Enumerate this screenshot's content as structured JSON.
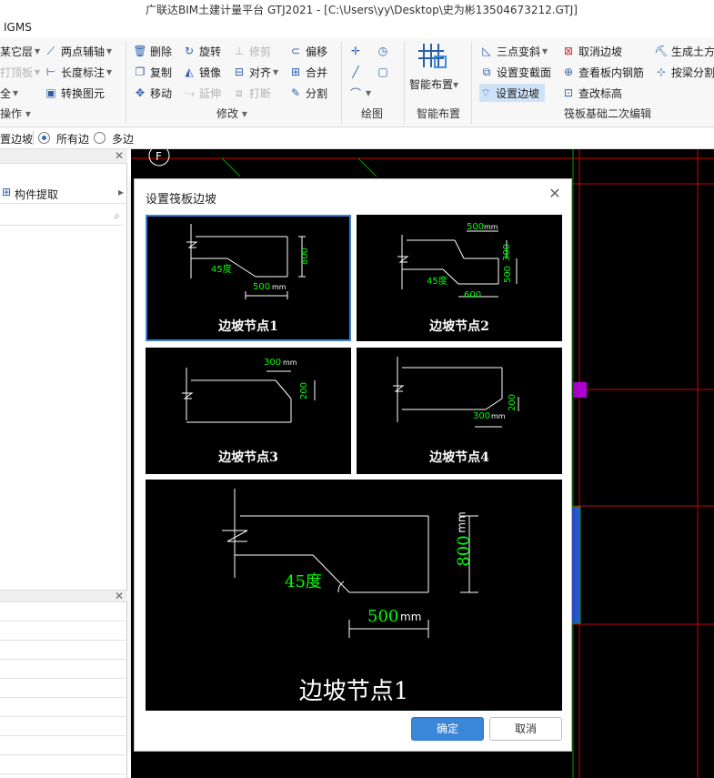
{
  "window": {
    "title": "广联达BIM土建计量平台 GTJ2021 - [C:\\Users\\yy\\Desktop\\史为彬13504673212.GTJ]"
  },
  "menu": {
    "first_item": "IGMS"
  },
  "ribbon": {
    "left_group": {
      "items": [
        "某它层",
        "打顶板",
        "全"
      ],
      "label": "操作"
    },
    "group2": {
      "items": [
        "两点辅轴",
        "长度标注",
        "转换图元"
      ]
    },
    "modify": {
      "label": "修改",
      "items": [
        "删除",
        "旋转",
        "修剪",
        "偏移",
        "复制",
        "镜像",
        "对齐",
        "合并",
        "移动",
        "延伸",
        "打断",
        "分割"
      ]
    },
    "draw": {
      "label": "绘图"
    },
    "smart": {
      "label": "智能布置",
      "button": "智能布置"
    },
    "raft": {
      "label": "筏板基础二次编辑",
      "items": [
        "三点变斜",
        "取消边坡",
        "生成土方",
        "设置变截面",
        "查看板内钢筋",
        "按梁分割",
        "设置边坡",
        "查改标高"
      ]
    }
  },
  "options_bar": {
    "prefix": "置边坡",
    "option1": "所有边",
    "option2": "多边",
    "selected": "option1"
  },
  "left_panel": {
    "tab": "构件提取"
  },
  "canvas": {
    "axis_label": "F"
  },
  "dialog": {
    "title": "设置筏板边坡",
    "nodes": [
      {
        "label": "边坡节点1",
        "angle": "45度",
        "dim_h": "800",
        "dim_w": "500",
        "unit": "mm"
      },
      {
        "label": "边坡节点2",
        "angle": "45度",
        "dim_top": "500",
        "dim_h1": "300",
        "dim_h2": "500",
        "dim_w": "600",
        "unit": "mm"
      },
      {
        "label": "边坡节点3",
        "dim_w": "300",
        "dim_h": "200",
        "unit": "mm"
      },
      {
        "label": "边坡节点4",
        "dim_w": "300",
        "dim_h": "200",
        "unit": "mm"
      }
    ],
    "selected_node": "边坡节点1",
    "preview": {
      "label": "边坡节点1",
      "angle": "45度",
      "dim_h": "800",
      "dim_w": "500",
      "unit": "mm"
    },
    "ok": "确定",
    "cancel": "取消"
  },
  "colors": {
    "accent": "#3a86d8",
    "dim_green": "#00ff00",
    "grid_red": "#e00000",
    "grid_green": "#00aa00",
    "magenta": "#b000d0",
    "blue_bar": "#2a58d8"
  }
}
